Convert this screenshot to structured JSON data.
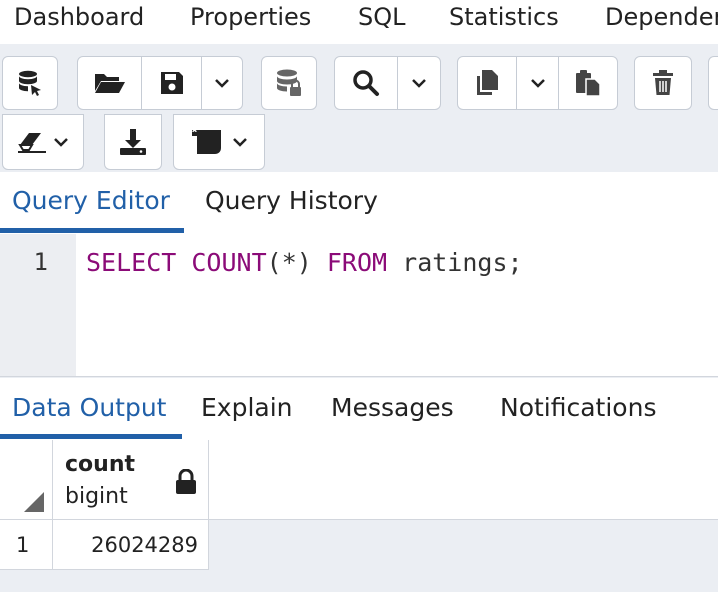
{
  "top_tabs": [
    "Dashboard",
    "Properties",
    "SQL",
    "Statistics",
    "Dependencies"
  ],
  "toolbar_icons": [
    "database-icon",
    "folder-open-icon",
    "save-icon",
    "chevron-down-icon",
    "database-lock-icon",
    "search-icon",
    "chevron-down-icon",
    "copy-icon",
    "chevron-down-icon",
    "paste-icon",
    "trash-icon",
    "eraser-icon",
    "download-icon",
    "scroll-icon"
  ],
  "query_tabs": {
    "editor": "Query Editor",
    "history": "Query History"
  },
  "editor": {
    "line_number": "1",
    "tokens": {
      "select": "SELECT",
      "count": "COUNT",
      "star": "(*)",
      "from": "FROM",
      "rest": "ratings;"
    }
  },
  "data_tabs": {
    "output": "Data Output",
    "explain": "Explain",
    "messages": "Messages",
    "notifications": "Notifications"
  },
  "grid": {
    "column": {
      "name": "count",
      "type": "bigint"
    },
    "rows": [
      {
        "num": "1",
        "value": "26024289"
      }
    ]
  },
  "colors": {
    "accent": "#2160a8",
    "keyword": "#8b0b78"
  }
}
